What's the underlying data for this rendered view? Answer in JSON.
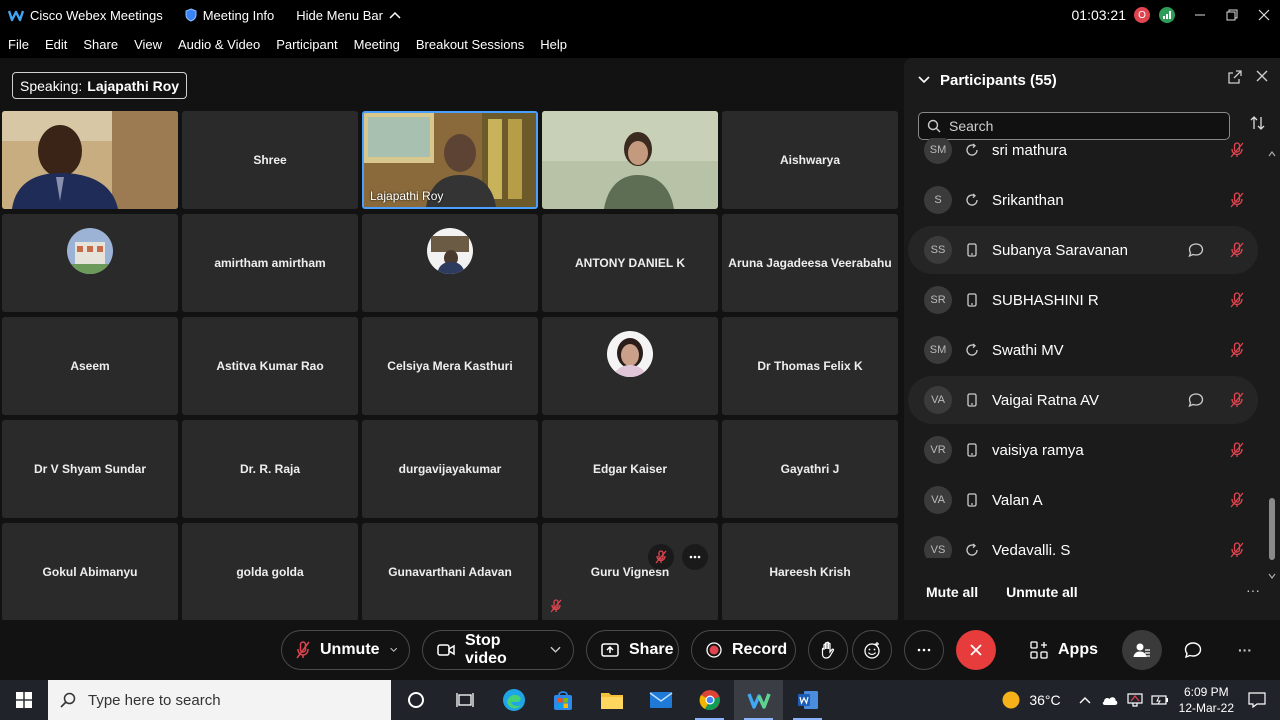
{
  "titlebar": {
    "app_name": "Cisco Webex Meetings",
    "meeting_info": "Meeting Info",
    "hide_menu": "Hide Menu Bar",
    "timer": "01:03:21",
    "badge_o": "O",
    "badge_d": "d"
  },
  "menu": [
    "File",
    "Edit",
    "Share",
    "View",
    "Audio & Video",
    "Participant",
    "Meeting",
    "Breakout Sessions",
    "Help"
  ],
  "speaking": {
    "prefix": "Speaking:",
    "name": "Lajapathi Roy"
  },
  "tiles": {
    "shree": "Shree",
    "lajapathi": "Lajapathi Roy",
    "aishwarya": "Aishwarya",
    "amirtham": "amirtham amirtham",
    "antony": "ANTONY DANIEL K",
    "aruna": "Aruna Jagadeesa Veerabahu",
    "aseem": "Aseem",
    "astitva": "Astitva Kumar Rao",
    "celsiya": "Celsiya Mera Kasthuri",
    "thomas": "Dr Thomas Felix K",
    "shyam": "Dr V Shyam Sundar",
    "raja": "Dr. R. Raja",
    "durga": "durgavijayakumar",
    "edgar": "Edgar Kaiser",
    "gayathri": "Gayathri J",
    "gokul": "Gokul Abimanyu",
    "golda": "golda golda",
    "gunavarthani": "Gunavarthani Adavan",
    "guru": "Guru Vignesh",
    "hareesh": "Hareesh Krish"
  },
  "panel": {
    "title": "Participants (55)",
    "search_placeholder": "Search",
    "participants": [
      {
        "initials": "SM",
        "name": "sri mathura",
        "device": "sync",
        "chat": false,
        "highlight": false
      },
      {
        "initials": "S",
        "name": "Srikanthan",
        "device": "sync",
        "chat": false,
        "highlight": false
      },
      {
        "initials": "SS",
        "name": "Subanya Saravanan",
        "device": "phone",
        "chat": true,
        "highlight": true
      },
      {
        "initials": "SR",
        "name": "SUBHASHINI R",
        "device": "phone",
        "chat": false,
        "highlight": false
      },
      {
        "initials": "SM",
        "name": "Swathi MV",
        "device": "sync",
        "chat": false,
        "highlight": false
      },
      {
        "initials": "VA",
        "name": "Vaigai Ratna AV",
        "device": "phone",
        "chat": true,
        "highlight": true
      },
      {
        "initials": "VR",
        "name": "vaisiya ramya",
        "device": "phone",
        "chat": false,
        "highlight": false
      },
      {
        "initials": "VA",
        "name": "Valan A",
        "device": "phone",
        "chat": false,
        "highlight": false
      },
      {
        "initials": "VS",
        "name": "Vedavalli. S",
        "device": "sync",
        "chat": false,
        "highlight": false
      }
    ],
    "mute_all": "Mute all",
    "unmute_all": "Unmute all",
    "more": "···"
  },
  "controls": {
    "unmute": "Unmute",
    "stop_video": "Stop video",
    "share": "Share",
    "record": "Record",
    "apps": "Apps",
    "more": "···"
  },
  "taskbar": {
    "search_placeholder": "Type here to search",
    "temperature": "36°C",
    "time": "6:09 PM",
    "date": "12-Mar-22"
  },
  "colors": {
    "accent_blue": "#4aa0ff",
    "end_red": "#e63c3c",
    "mute_red": "#e0454f",
    "badge_red": "#e0454f",
    "badge_green": "#2e9d57"
  }
}
